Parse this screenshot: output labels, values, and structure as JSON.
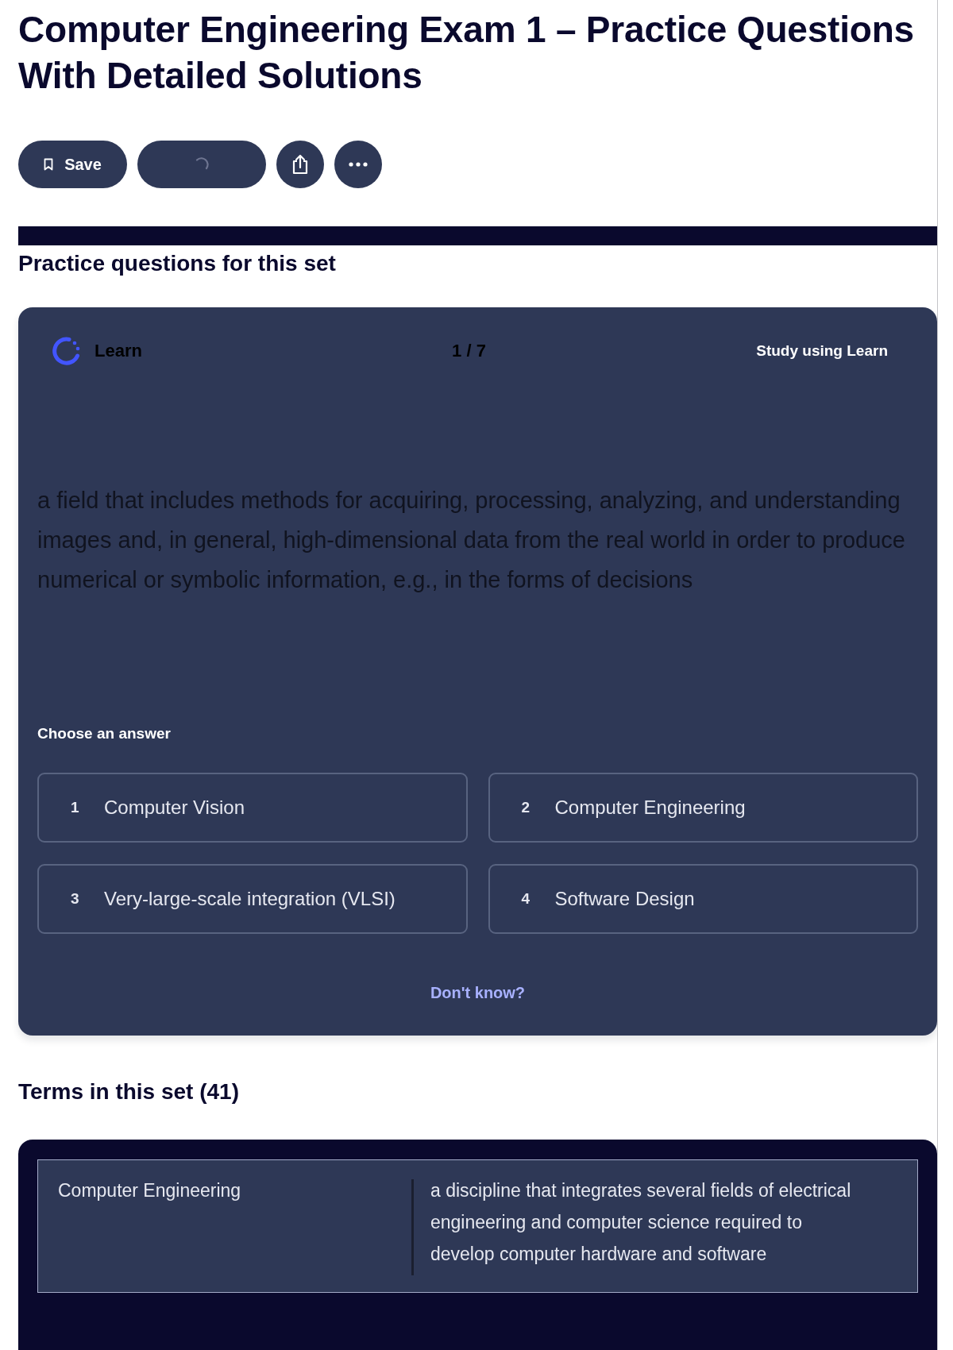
{
  "title": "Computer Engineering Exam 1 – Practice Questions With Detailed Solutions",
  "actions": [
    {
      "kind": "save",
      "label": "Save"
    },
    {
      "kind": "loading"
    },
    {
      "kind": "share"
    },
    {
      "kind": "more"
    }
  ],
  "practice": {
    "heading": "Practice questions for this set",
    "mode": "Learn",
    "progress": "1 / 7",
    "study_link": "Study using Learn",
    "question": "a field that includes methods for acquiring, processing, analyzing, and understanding images and, in general, high-dimensional data from the real world in order to produce numerical or symbolic information, e.g., in the forms of decisions",
    "prompt": "Choose an answer",
    "answers": [
      {
        "number": "1",
        "text": "Computer Vision",
        "selected": false
      },
      {
        "number": "2",
        "text": "Computer Engineering",
        "selected": false
      },
      {
        "number": "3",
        "text": "Very-large-scale integration (VLSI)",
        "selected": false
      },
      {
        "number": "4",
        "text": "Software Design",
        "selected": false
      }
    ],
    "skip": "Don't know?"
  },
  "terms": {
    "heading": "Terms in this set (41)",
    "items": [
      {
        "term": "Computer Engineering",
        "definition": "a discipline that integrates several fields of electrical engineering and computer science required to develop computer hardware and software"
      }
    ]
  }
}
